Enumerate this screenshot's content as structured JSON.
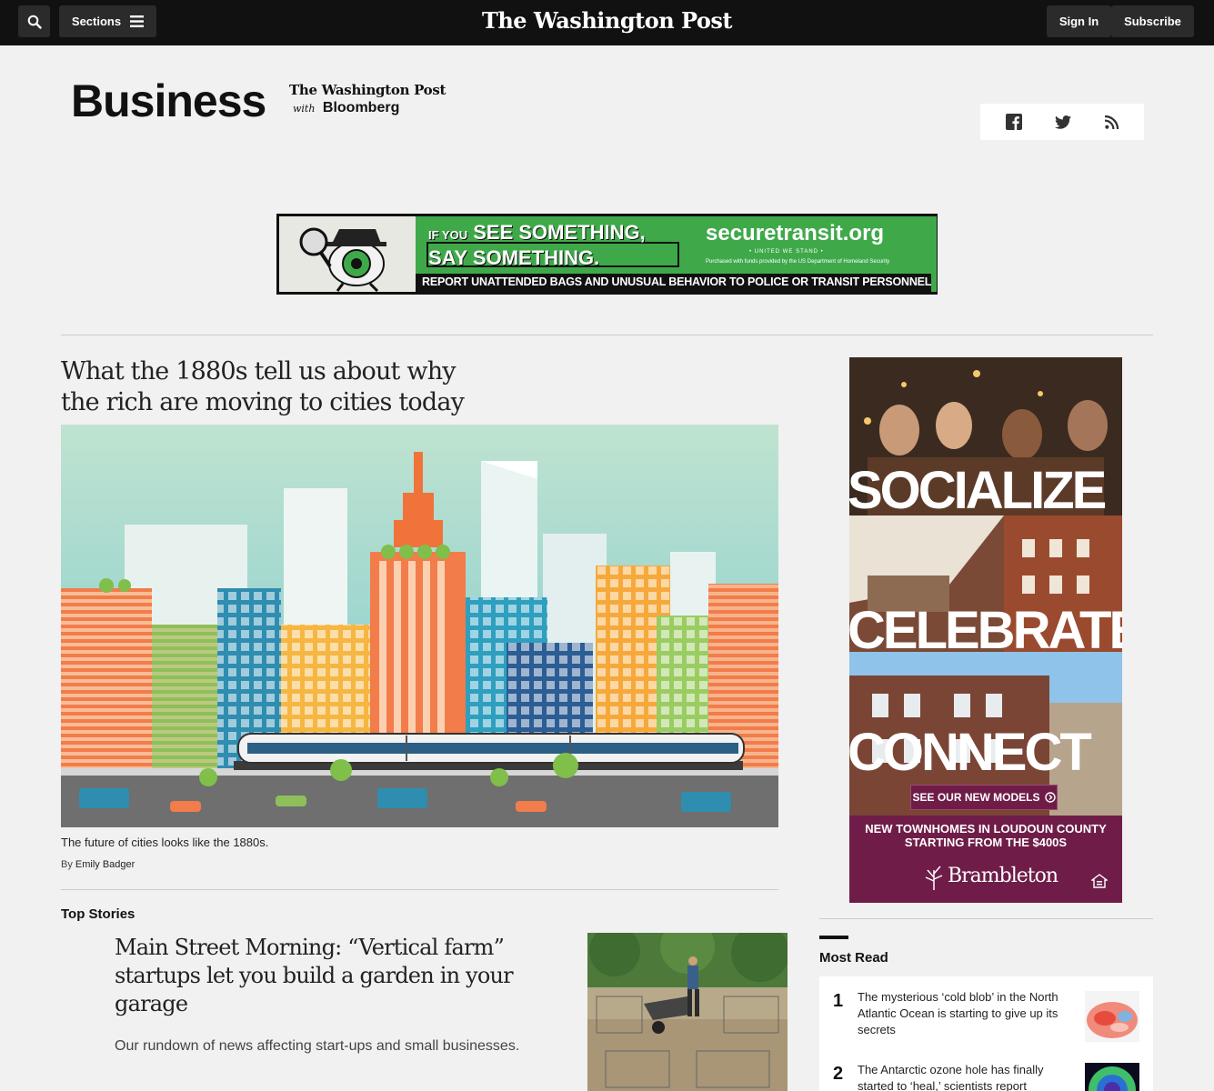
{
  "topbar": {
    "sections_label": "Sections",
    "masthead": "The Washington Post",
    "signin_label": "Sign In",
    "subscribe_label": "Subscribe",
    "icons": [
      "search-icon",
      "hamburger-menu-icon"
    ]
  },
  "section": {
    "title": "Business",
    "partner_wapo": "The Washington Post",
    "partner_with": "with",
    "partner_bloomberg": "Bloomberg",
    "social_icons": [
      "facebook-icon",
      "twitter-icon",
      "rss-icon"
    ]
  },
  "banner_ad": {
    "if_you": "IF YOU",
    "line1": "SEE SOMETHING,",
    "line2": "SAY SOMETHING.",
    "url": "securetransit.org",
    "tag": "• UNITED WE STAND •",
    "funding": "Purchased with funds provided by the US Department of Homeland Security",
    "report": "REPORT UNATTENDED BAGS  AND UNUSUAL BEHAVIOR TO POLICE OR TRANSIT PERSONNEL"
  },
  "lead": {
    "headline": "What the 1880s tell us about why the rich are moving to cities today",
    "caption": "The future of cities looks like the 1880s.",
    "byline_prefix": "By",
    "author": "Emily Badger"
  },
  "top_stories": {
    "label": "Top Stories",
    "headline": "Main Street Morning: “Vertical farm” startups let you build a garden in your garage",
    "blurb": "Our rundown of news affecting start-ups and small businesses."
  },
  "side_ad": {
    "word1": "SOCIALIZE",
    "word2": "CELEBRATE",
    "word3": "CONNECT",
    "cta": "SEE OUR NEW MODELS",
    "line1": "NEW TOWNHOMES IN LOUDOUN COUNTY",
    "line2": "STARTING FROM THE $400S",
    "brand": "Brambleton"
  },
  "most_read": {
    "title": "Most Read",
    "items": [
      {
        "rank": "1",
        "text": "The mysterious ‘cold blob’ in the North Atlantic Ocean is starting to give up its secrets"
      },
      {
        "rank": "2",
        "text": "The Antarctic ozone hole has finally started to ‘heal,’ scientists report"
      }
    ]
  },
  "colors": {
    "topbar": "#111111",
    "page_bg": "#f1f1f1",
    "banner_green": "#3fa94a",
    "ad_maroon": "#6f1d48"
  }
}
